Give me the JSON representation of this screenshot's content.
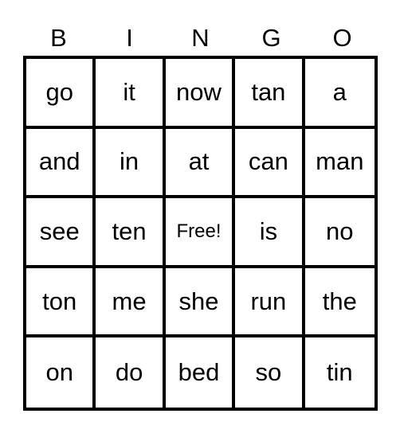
{
  "header": [
    "B",
    "I",
    "N",
    "G",
    "O"
  ],
  "cells": [
    "go",
    "it",
    "now",
    "tan",
    "a",
    "and",
    "in",
    "at",
    "can",
    "man",
    "see",
    "ten",
    "Free!",
    "is",
    "no",
    "ton",
    "me",
    "she",
    "run",
    "the",
    "on",
    "do",
    "bed",
    "so",
    "tin"
  ],
  "free_index": 12
}
